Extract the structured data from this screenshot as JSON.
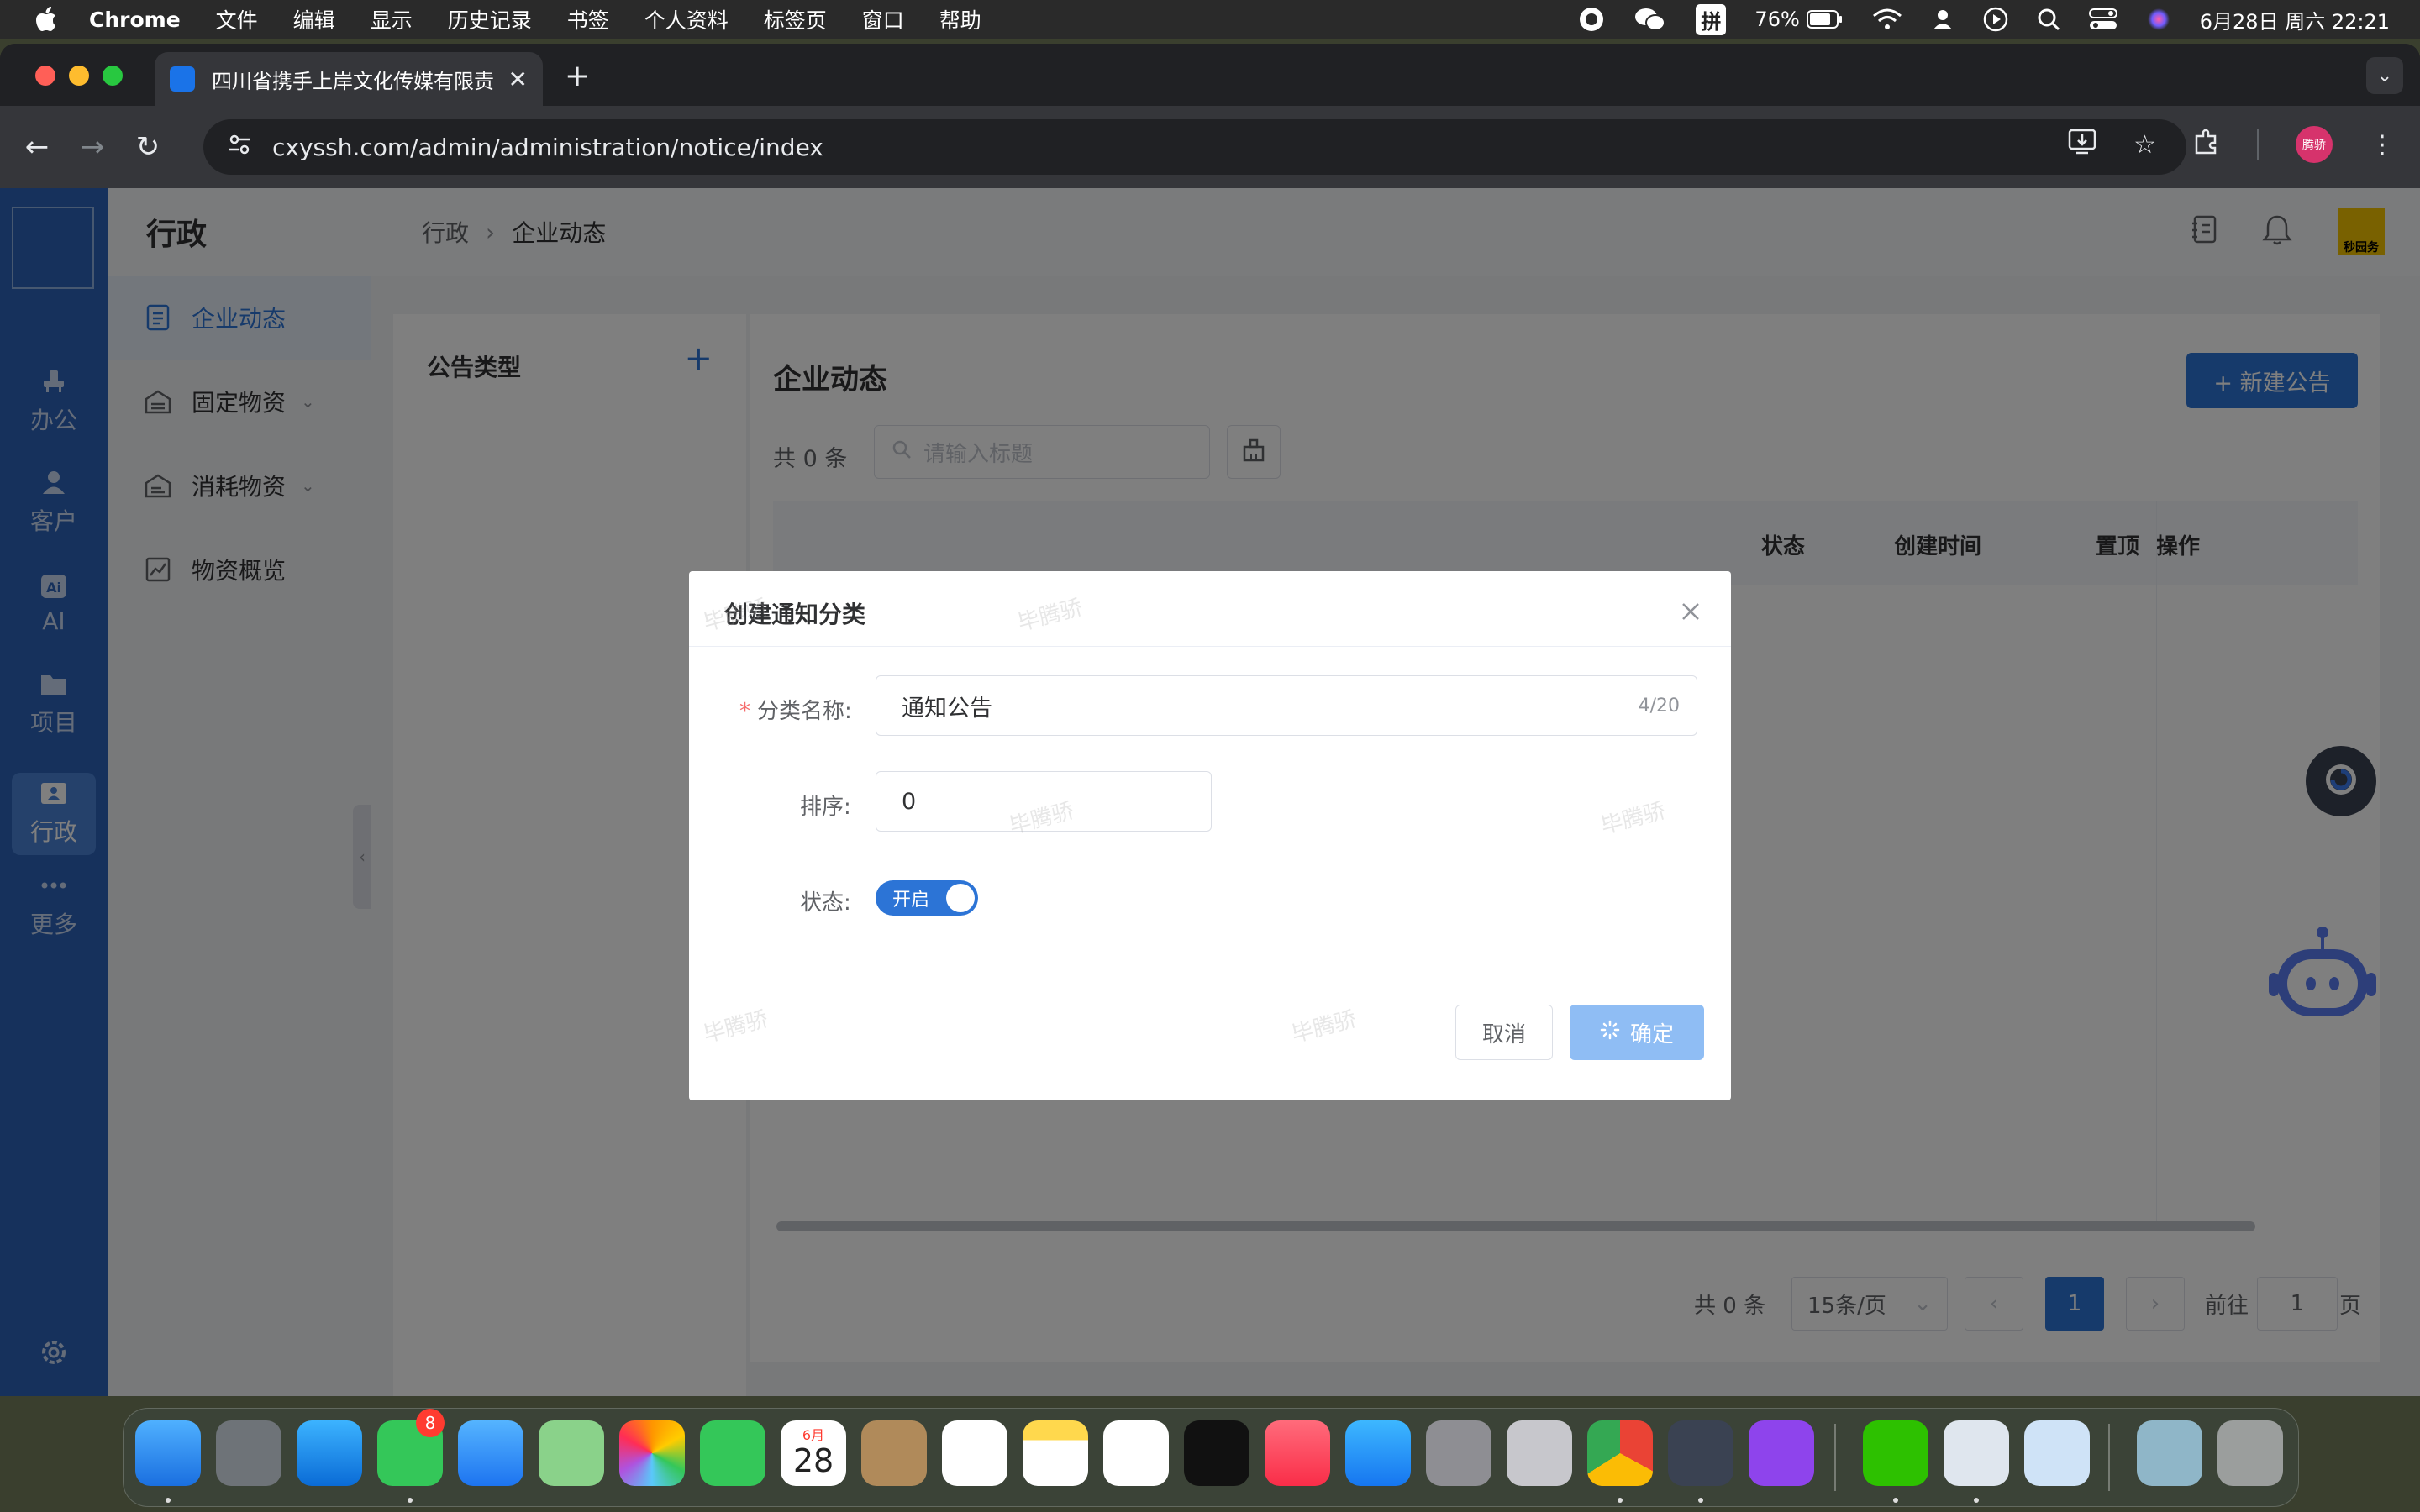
{
  "menubar": {
    "app": "Chrome",
    "items": [
      "文件",
      "编辑",
      "显示",
      "历史记录",
      "书签",
      "个人资料",
      "标签页",
      "窗口",
      "帮助"
    ],
    "ime": "拼",
    "battery": "76%",
    "datetime": "6月28日 周六  22:21"
  },
  "browser": {
    "tab_title": "四川省携手上岸文化传媒有限责",
    "url": "cxyssh.com/admin/administration/notice/index",
    "profile_label": "腾骄"
  },
  "rail": {
    "items": [
      {
        "label": "办公",
        "icon": "office-icon"
      },
      {
        "label": "客户",
        "icon": "customer-icon"
      },
      {
        "label": "AI",
        "icon": "ai-icon"
      },
      {
        "label": "项目",
        "icon": "folder-icon"
      },
      {
        "label": "行政",
        "icon": "admin-icon",
        "active": true
      },
      {
        "label": "更多",
        "icon": "more-icon"
      }
    ]
  },
  "sidebar": {
    "title": "行政",
    "items": [
      {
        "label": "企业动态",
        "active": true
      },
      {
        "label": "固定物资",
        "expandable": true
      },
      {
        "label": "消耗物资",
        "expandable": true
      },
      {
        "label": "物资概览"
      }
    ]
  },
  "breadcrumb": {
    "root": "行政",
    "current": "企业动态"
  },
  "header": {
    "logo_text": "秒园务"
  },
  "left_panel": {
    "title": "公告类型"
  },
  "main": {
    "title": "企业动态",
    "new_button": "+ 新建公告",
    "count": "共 0 条",
    "search_placeholder": "请输入标题",
    "columns": [
      "状态",
      "创建时间",
      "置顶",
      "操作"
    ],
    "pager": {
      "total": "共 0 条",
      "size": "15条/页",
      "current": "1",
      "goto_label": "前往",
      "goto_value": "1",
      "goto_unit": "页"
    }
  },
  "dialog": {
    "title": "创建通知分类",
    "name_label": "分类名称:",
    "name_value": "通知公告",
    "name_count": "4/20",
    "sort_label": "排序:",
    "sort_value": "0",
    "status_label": "状态:",
    "status_value": "开启",
    "cancel": "取消",
    "ok": "确定"
  },
  "watermark": "毕腾骄",
  "dock": {
    "calendar_month": "6月",
    "calendar_day": "28",
    "messages_badge": "8"
  },
  "colors": {
    "primary": "#2c74d6",
    "rail": "#2c63b8",
    "required": "#f56c6c"
  }
}
